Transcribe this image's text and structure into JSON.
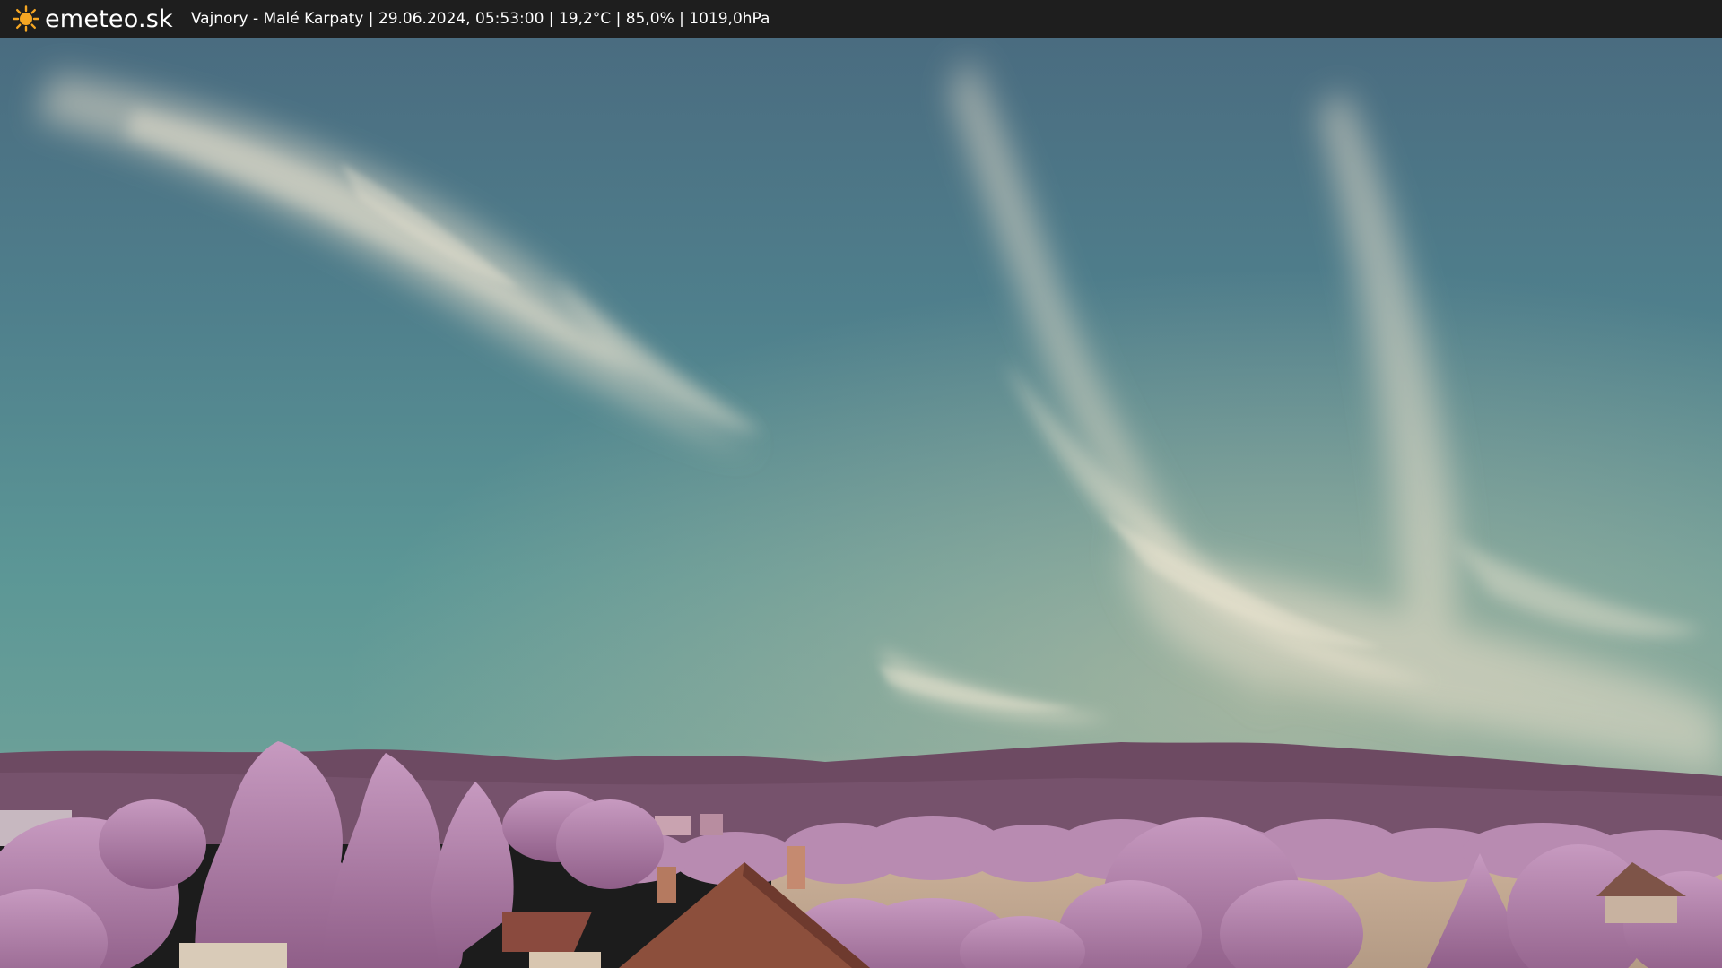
{
  "header": {
    "logo_icon": "sun-icon",
    "site_name": "emeteo.sk",
    "location": "Vajnory - Malé Karpaty",
    "timestamp": "29.06.2024, 05:53:00",
    "temperature": "19,2°C",
    "humidity": "85,0%",
    "pressure": "1019,0hPa",
    "separator": " | "
  },
  "colors": {
    "bar_background": "#1e1e1e",
    "sun": "#f5a623",
    "sky_top": "#4a6f82",
    "sky_bottom": "#5f9a9a",
    "mountains": "#6e4a62",
    "foliage": "#b98ab2",
    "roof": "#8a4a3a"
  }
}
